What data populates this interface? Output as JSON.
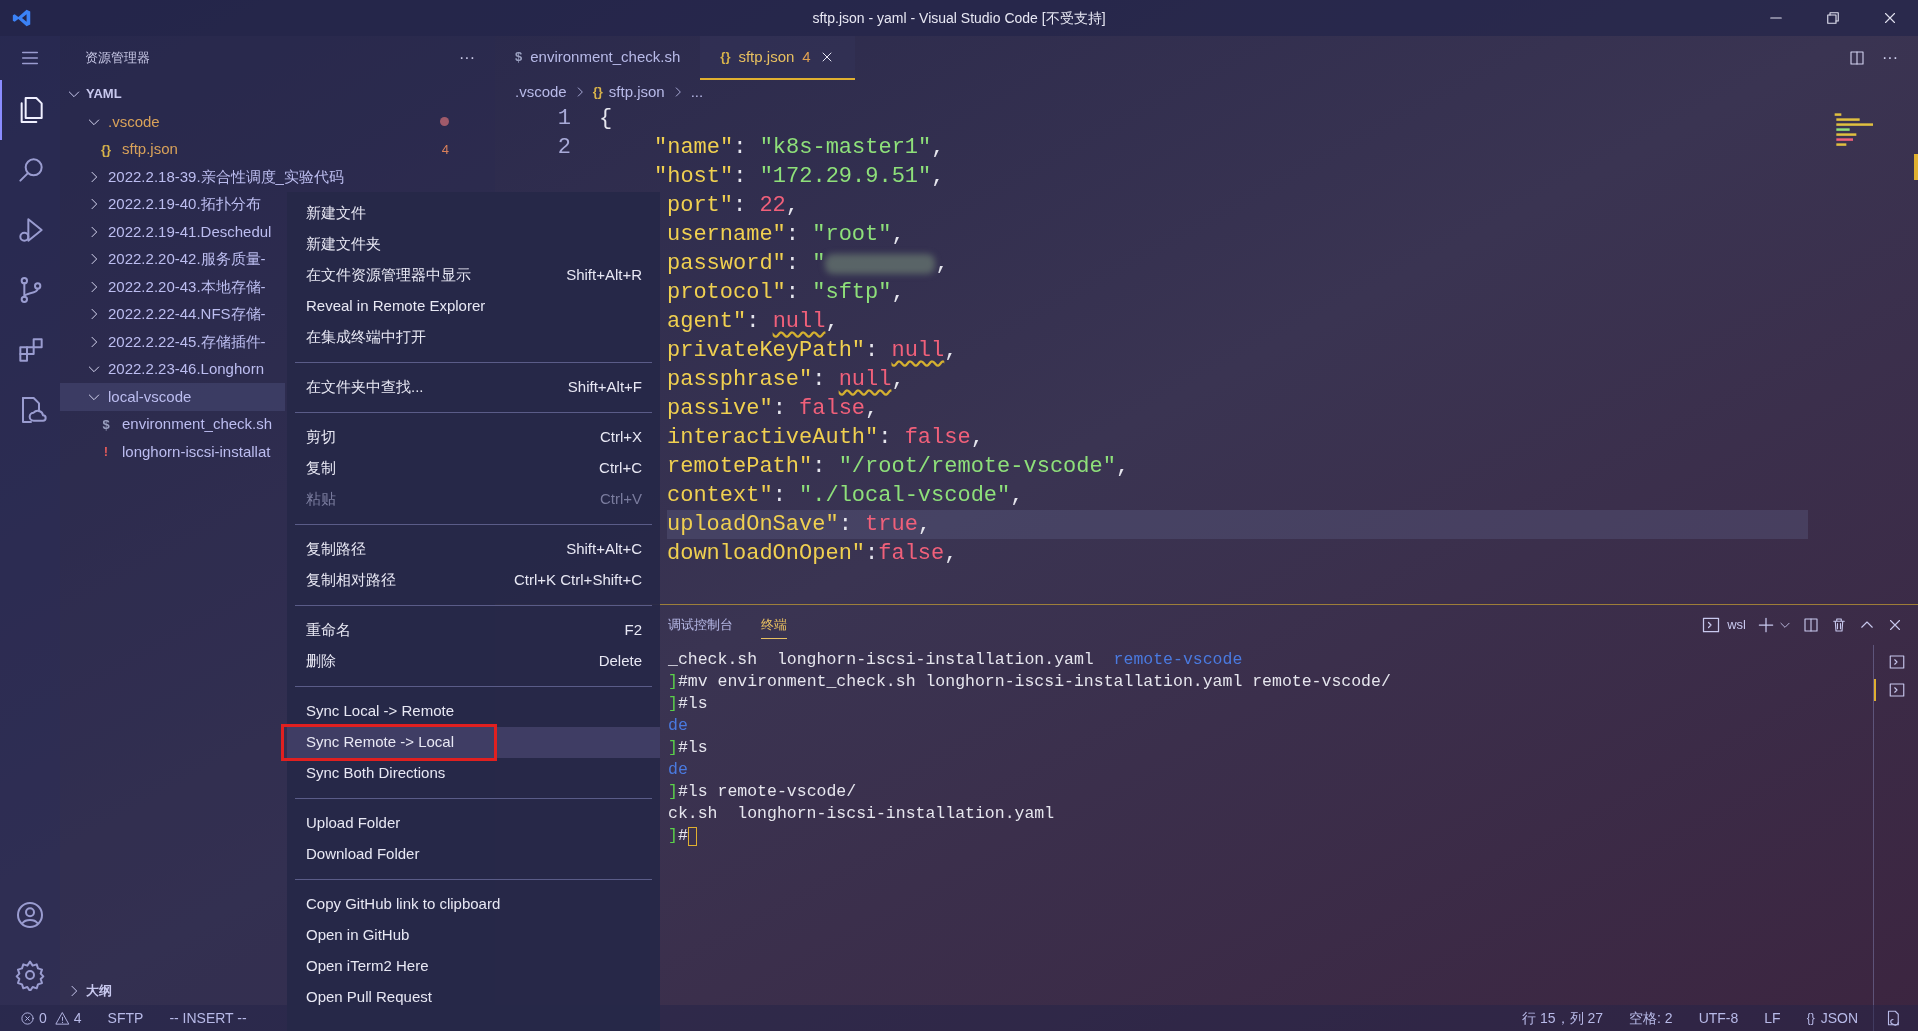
{
  "window": {
    "title": "sftp.json - yaml - Visual Studio Code [不受支持]"
  },
  "activity_bar": {
    "top": [
      {
        "kind": "files",
        "selected": true
      },
      {
        "kind": "search",
        "selected": false
      },
      {
        "kind": "debug",
        "selected": false
      },
      {
        "kind": "branch",
        "selected": false
      },
      {
        "kind": "extensions",
        "selected": false
      },
      {
        "kind": "remote",
        "selected": false
      }
    ],
    "bottom": [
      {
        "kind": "account"
      },
      {
        "kind": "settings"
      }
    ]
  },
  "sidebar": {
    "title": "资源管理器",
    "more": "···",
    "section": {
      "label": "YAML",
      "expanded": true,
      "children": [
        {
          "label": ".vscode",
          "kind": "folder",
          "expanded": true,
          "modified": true,
          "selected": false,
          "children": [
            {
              "label": "sftp.json",
              "kind": "json",
              "icon": "{}",
              "modified": true,
              "badge": "4",
              "selected": false
            }
          ]
        },
        {
          "label": "2022.2.18-39.亲合性调度_实验代码",
          "kind": "folder",
          "expanded": false,
          "modified": false,
          "selected": false
        },
        {
          "label": "2022.2.19-40.拓扑分布",
          "kind": "folder",
          "expanded": false,
          "modified": false,
          "selected": false
        },
        {
          "label": "2022.2.19-41.Deschedul",
          "kind": "folder",
          "expanded": false,
          "modified": false,
          "selected": false
        },
        {
          "label": "2022.2.20-42.服务质量-",
          "kind": "folder",
          "expanded": false,
          "modified": false,
          "selected": false
        },
        {
          "label": "2022.2.20-43.本地存储-",
          "kind": "folder",
          "expanded": false,
          "modified": false,
          "selected": false
        },
        {
          "label": "2022.2.22-44.NFS存储-",
          "kind": "folder",
          "expanded": false,
          "modified": false,
          "selected": false
        },
        {
          "label": "2022.2.22-45.存储插件-",
          "kind": "folder",
          "expanded": false,
          "modified": false,
          "selected": false
        },
        {
          "label": "2022.2.23-46.Longhorn",
          "kind": "folder",
          "expanded": true,
          "modified": false,
          "selected": false
        },
        {
          "label": "local-vscode",
          "kind": "folder",
          "expanded": true,
          "modified": false,
          "selected": true,
          "children": [
            {
              "label": "environment_check.sh",
              "kind": "shell",
              "icon": "$",
              "modified": false,
              "selected": false
            },
            {
              "label": "longhorn-iscsi-installat",
              "kind": "yaml",
              "icon": "!",
              "modified": false,
              "selected": false
            }
          ]
        }
      ]
    },
    "outline": {
      "label": "大纲",
      "expanded": false
    }
  },
  "tabs": [
    {
      "icon": "$",
      "kind": "shell",
      "label": "environment_check.sh",
      "selected": false
    },
    {
      "icon": "{}",
      "kind": "json",
      "label": "sftp.json",
      "badge": "4",
      "selected": true
    }
  ],
  "editor_actions": {
    "more": "···"
  },
  "breadcrumbs": [
    {
      "label": ".vscode"
    },
    {
      "icon": "{}",
      "label": "sftp.json"
    },
    {
      "label": "..."
    }
  ],
  "editor": {
    "line_numbers": [
      "1",
      "2"
    ],
    "lines": [
      {
        "kind": "open",
        "current": false,
        "segments": [
          {
            "kind": "punct",
            "t": "{"
          }
        ]
      },
      {
        "kind": "entry",
        "current": false,
        "segments": [
          {
            "kind": "key",
            "t": "\"name\""
          },
          {
            "kind": "punct",
            "t": ": "
          },
          {
            "kind": "string",
            "t": "\"k8s-master1\""
          },
          {
            "kind": "punct",
            "t": ","
          }
        ]
      },
      {
        "kind": "entry",
        "current": false,
        "segments": [
          {
            "kind": "key",
            "t": "\"host\""
          },
          {
            "kind": "punct",
            "t": ": "
          },
          {
            "kind": "string",
            "t": "\"172.29.9.51\""
          },
          {
            "kind": "punct",
            "t": ","
          }
        ]
      },
      {
        "kind": "cut",
        "current": false,
        "segments": [
          {
            "kind": "key",
            "t": "port\""
          },
          {
            "kind": "punct",
            "t": ": "
          },
          {
            "kind": "literal",
            "t": "22"
          },
          {
            "kind": "punct",
            "t": ","
          }
        ]
      },
      {
        "kind": "cut",
        "current": false,
        "segments": [
          {
            "kind": "key",
            "t": "username\""
          },
          {
            "kind": "punct",
            "t": ": "
          },
          {
            "kind": "string",
            "t": "\"root\""
          },
          {
            "kind": "punct",
            "t": ","
          }
        ]
      },
      {
        "kind": "cut",
        "current": false,
        "segments": [
          {
            "kind": "key",
            "t": "password\""
          },
          {
            "kind": "punct",
            "t": ": "
          },
          {
            "kind": "string",
            "t": "\""
          },
          {
            "kind": "redacted"
          },
          {
            "kind": "punct",
            "t": ","
          }
        ]
      },
      {
        "kind": "cut",
        "current": false,
        "segments": [
          {
            "kind": "key",
            "t": "protocol\""
          },
          {
            "kind": "punct",
            "t": ": "
          },
          {
            "kind": "string",
            "t": "\"sftp\""
          },
          {
            "kind": "punct",
            "t": ","
          }
        ]
      },
      {
        "kind": "cut",
        "current": false,
        "segments": [
          {
            "kind": "key",
            "t": "agent\""
          },
          {
            "kind": "punct",
            "t": ": "
          },
          {
            "kind": "literal",
            "t": "null",
            "warning": true
          },
          {
            "kind": "punct",
            "t": ","
          }
        ]
      },
      {
        "kind": "cut",
        "current": false,
        "segments": [
          {
            "kind": "key",
            "t": "privateKeyPath\""
          },
          {
            "kind": "punct",
            "t": ": "
          },
          {
            "kind": "literal",
            "t": "null",
            "warning": true
          },
          {
            "kind": "punct",
            "t": ","
          }
        ]
      },
      {
        "kind": "cut",
        "current": false,
        "segments": [
          {
            "kind": "key",
            "t": "passphrase\""
          },
          {
            "kind": "punct",
            "t": ": "
          },
          {
            "kind": "literal",
            "t": "null",
            "warning": true
          },
          {
            "kind": "punct",
            "t": ","
          }
        ]
      },
      {
        "kind": "cut",
        "current": false,
        "segments": [
          {
            "kind": "key",
            "t": "passive\""
          },
          {
            "kind": "punct",
            "t": ": "
          },
          {
            "kind": "literal",
            "t": "false"
          },
          {
            "kind": "punct",
            "t": ","
          }
        ]
      },
      {
        "kind": "cut",
        "current": false,
        "segments": [
          {
            "kind": "key",
            "t": "interactiveAuth\""
          },
          {
            "kind": "punct",
            "t": ": "
          },
          {
            "kind": "literal",
            "t": "false"
          },
          {
            "kind": "punct",
            "t": ","
          }
        ]
      },
      {
        "kind": "cut",
        "current": false,
        "segments": [
          {
            "kind": "key",
            "t": "remotePath\""
          },
          {
            "kind": "punct",
            "t": ": "
          },
          {
            "kind": "string",
            "t": "\"/root/remote-vscode\""
          },
          {
            "kind": "punct",
            "t": ","
          }
        ]
      },
      {
        "kind": "cut",
        "current": false,
        "segments": [
          {
            "kind": "key",
            "t": "context\""
          },
          {
            "kind": "punct",
            "t": ": "
          },
          {
            "kind": "string",
            "t": "\"./local-vscode\""
          },
          {
            "kind": "punct",
            "t": ","
          }
        ]
      },
      {
        "kind": "cut",
        "current": true,
        "segments": [
          {
            "kind": "key",
            "t": "uploadOnSave\""
          },
          {
            "kind": "punct",
            "t": ": "
          },
          {
            "kind": "literal",
            "t": "true"
          },
          {
            "kind": "punct",
            "t": ","
          }
        ]
      },
      {
        "kind": "cut",
        "current": false,
        "segments": [
          {
            "kind": "key",
            "t": "downloadOnOpen\""
          },
          {
            "kind": "punct",
            "t": ":"
          },
          {
            "kind": "literal",
            "t": "false"
          },
          {
            "kind": "punct",
            "t": ","
          }
        ]
      }
    ]
  },
  "context_menu": {
    "groups": [
      [
        {
          "label": "新建文件",
          "disabled": false,
          "selected": false,
          "annotated": false
        },
        {
          "label": "新建文件夹",
          "disabled": false,
          "selected": false,
          "annotated": false
        },
        {
          "label": "在文件资源管理器中显示",
          "shortcut": "Shift+Alt+R",
          "disabled": false,
          "selected": false,
          "annotated": false
        },
        {
          "label": "Reveal in Remote Explorer",
          "disabled": false,
          "selected": false,
          "annotated": false
        },
        {
          "label": "在集成终端中打开",
          "disabled": false,
          "selected": false,
          "annotated": false
        }
      ],
      [
        {
          "label": "在文件夹中查找...",
          "shortcut": "Shift+Alt+F",
          "disabled": false,
          "selected": false,
          "annotated": false
        }
      ],
      [
        {
          "label": "剪切",
          "shortcut": "Ctrl+X",
          "disabled": false,
          "selected": false,
          "annotated": false
        },
        {
          "label": "复制",
          "shortcut": "Ctrl+C",
          "disabled": false,
          "selected": false,
          "annotated": false
        },
        {
          "label": "粘贴",
          "shortcut": "Ctrl+V",
          "disabled": true,
          "selected": false,
          "annotated": false
        }
      ],
      [
        {
          "label": "复制路径",
          "shortcut": "Shift+Alt+C",
          "disabled": false,
          "selected": false,
          "annotated": false
        },
        {
          "label": "复制相对路径",
          "shortcut": "Ctrl+K Ctrl+Shift+C",
          "disabled": false,
          "selected": false,
          "annotated": false
        }
      ],
      [
        {
          "label": "重命名",
          "shortcut": "F2",
          "disabled": false,
          "selected": false,
          "annotated": false
        },
        {
          "label": "删除",
          "shortcut": "Delete",
          "disabled": false,
          "selected": false,
          "annotated": false
        }
      ],
      [
        {
          "label": "Sync Local -> Remote",
          "disabled": false,
          "selected": false,
          "annotated": false
        },
        {
          "label": "Sync Remote -> Local",
          "disabled": false,
          "selected": true,
          "annotated": true
        },
        {
          "label": "Sync Both Directions",
          "disabled": false,
          "selected": false,
          "annotated": false
        }
      ],
      [
        {
          "label": "Upload Folder",
          "disabled": false,
          "selected": false,
          "annotated": false
        },
        {
          "label": "Download Folder",
          "disabled": false,
          "selected": false,
          "annotated": false
        }
      ],
      [
        {
          "label": "Copy GitHub link to clipboard",
          "disabled": false,
          "selected": false,
          "annotated": false
        },
        {
          "label": "Open in GitHub",
          "disabled": false,
          "selected": false,
          "annotated": false
        },
        {
          "label": "Open iTerm2 Here",
          "disabled": false,
          "selected": false,
          "annotated": false
        },
        {
          "label": "Open Pull Request",
          "disabled": false,
          "selected": false,
          "annotated": false
        }
      ]
    ]
  },
  "panel": {
    "tabs": [
      {
        "label": "调试控制台",
        "selected": false
      },
      {
        "label": "终端",
        "selected": true
      }
    ],
    "shell": "wsl",
    "terminal_lines": [
      [
        {
          "kind": "text",
          "t": "_check.sh  longhorn-iscsi-installation.yaml  "
        },
        {
          "kind": "dir",
          "t": "remote-vscode"
        }
      ],
      [
        {
          "kind": "prompt",
          "t": "]"
        },
        {
          "kind": "text",
          "t": "#mv environment_check.sh longhorn-iscsi-installation.yaml remote-vscode/"
        }
      ],
      [
        {
          "kind": "prompt",
          "t": "]"
        },
        {
          "kind": "text",
          "t": "#ls"
        }
      ],
      [
        {
          "kind": "dir",
          "t": "de"
        }
      ],
      [
        {
          "kind": "prompt",
          "t": "]"
        },
        {
          "kind": "text",
          "t": "#ls"
        }
      ],
      [
        {
          "kind": "dir",
          "t": "de"
        }
      ],
      [
        {
          "kind": "prompt",
          "t": "]"
        },
        {
          "kind": "text",
          "t": "#ls remote-vscode/"
        }
      ],
      [
        {
          "kind": "text",
          "t": "ck.sh  longhorn-iscsi-installation.yaml"
        }
      ],
      [
        {
          "kind": "prompt",
          "t": "]"
        },
        {
          "kind": "text",
          "t": "#"
        },
        {
          "kind": "cursor"
        }
      ]
    ],
    "terminals": [
      {
        "selected": false
      },
      {
        "selected": true
      }
    ]
  },
  "status_bar": {
    "left": [
      {
        "kind": "problems",
        "errors": "0",
        "warnings": "4"
      },
      {
        "kind": "text",
        "label": "SFTP"
      },
      {
        "kind": "text",
        "label": "-- INSERT --"
      }
    ],
    "right": [
      {
        "kind": "text",
        "label": "行 15，列 27"
      },
      {
        "kind": "text",
        "label": "空格: 2"
      },
      {
        "kind": "text",
        "label": "UTF-8"
      },
      {
        "kind": "text",
        "label": "LF"
      },
      {
        "kind": "lang",
        "icon": "{}",
        "label": "JSON"
      },
      {
        "kind": "feedback"
      }
    ]
  }
}
